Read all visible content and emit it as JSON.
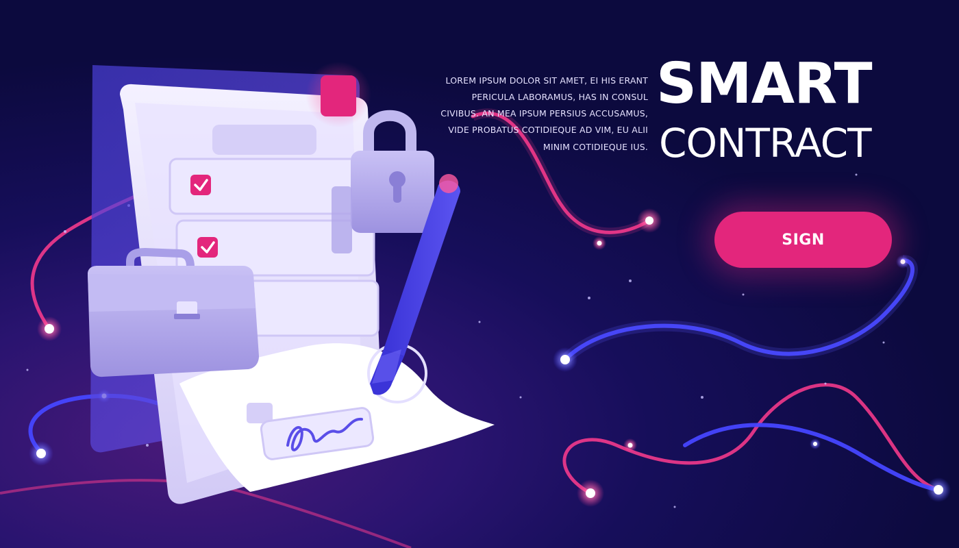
{
  "hero": {
    "description": "Lorem ipsum dolor sit amet, ei his erant pericula laboramus, has in consul civibus. An mea ipsum persius accusamus, vide probatus cotidieque ad vim, eu alii minim cotidieque ius.",
    "title_line1": "SMART",
    "title_line2": "CONTRACT"
  },
  "actions": {
    "sign_label": "SIGN"
  },
  "illustration": {
    "icons": [
      "clipboard-icon",
      "padlock-icon",
      "briefcase-icon",
      "pen-icon",
      "checkbox-icon",
      "signature-icon"
    ]
  },
  "colors": {
    "background_dark": "#0c0a3e",
    "background_mid": "#2a1470",
    "accent_pink": "#e3267c",
    "accent_blue": "#3a3ad8",
    "document_light": "#eeeaff",
    "object_lavender": "#b7aeeb"
  }
}
